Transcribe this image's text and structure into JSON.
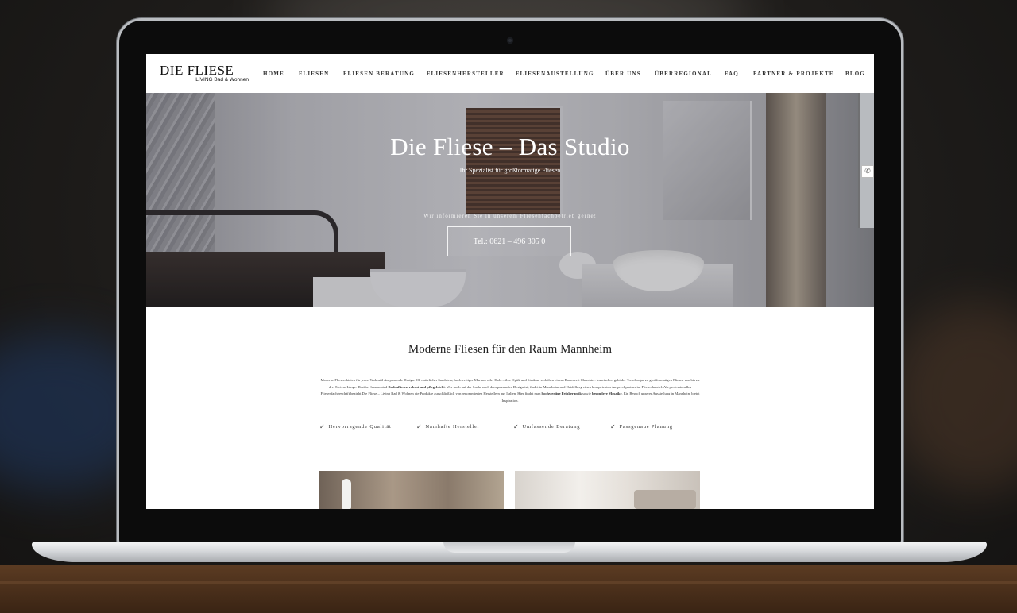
{
  "site": {
    "logo_title": "DIE FLIESE",
    "logo_subtitle": "LIVING Bad & Wohnen",
    "nav": [
      "HOME",
      "FLIESEN",
      "FLIESEN BERATUNG",
      "FLIESENHERSTELLER",
      "FLIESENAUSTELLUNG",
      "ÜBER UNS",
      "ÜBERREGIONAL",
      "FAQ",
      "PARTNER & PROJEKTE",
      "BLOG"
    ]
  },
  "hero": {
    "title": "Die Fliese – Das Studio",
    "subtitle": "Ihr Spezialist für großformatige Fliesen",
    "info": "Wir informieren Sie in unserem Fliesenfachbetrieb gerne!",
    "phone_button": "Tel.: 0621 – 496 305 0",
    "side_icon": "phone-icon"
  },
  "content": {
    "title": "Moderne Fliesen für den Raum Mannheim",
    "paragraph_parts": [
      "Moderne Fliesen bieten für jeden Wohnstil das passende Design. Ob natürlicher Sandstein, hochwertiger Marmor oder Holz – ihre Optik und Struktur verleihen einem Raum erst Charakter. Inzwischen geht der Trend sogar zu großformatigen Fliesen von bis zu drei Metern Länge. Darüber hinaus sind ",
      "Bodenfliesen robust und pflegeleicht",
      ". Wer noch auf der Suche nach dem passenden Design ist, findet in Mannheim und Heidelberg einen kompetenten Ansprechpartner im Fliesenhandel. Als professionelles Fliesenfachgeschäft bezieht Die Fliese – Living Bad & Wohnen die Produkte ausschließlich von renommierten Herstellern aus Italien. Hier findet man ",
      "hochwertige Feinkeramik",
      " sowie ",
      "besondere Mosaike",
      ". Ein Besuch unserer Ausstellung in Mannheim bietet Inspiration."
    ],
    "features": [
      "Hervorragende Qualität",
      "Namhafte Hersteller",
      "Umfassende Beratung",
      "Passgenaue Planung"
    ],
    "feature_icon": "check-icon"
  }
}
